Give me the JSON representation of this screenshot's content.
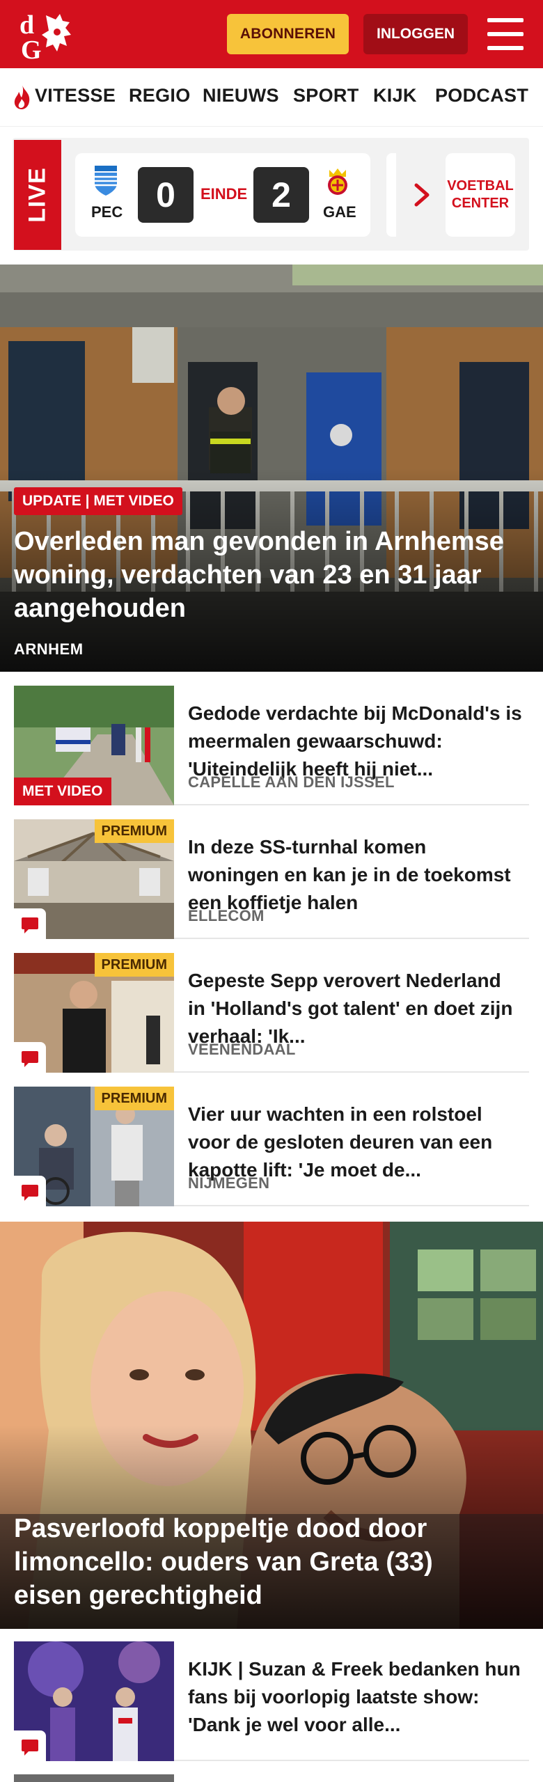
{
  "header": {
    "logo_letters": "dG",
    "subscribe_label": "ABONNEREN",
    "login_label": "INLOGGEN",
    "brand_color": "#d3101d",
    "accent_color": "#f7c33a"
  },
  "nav": {
    "items": [
      "VITESSE",
      "REGIO",
      "NIEUWS",
      "SPORT",
      "KIJK",
      "PODCAST"
    ]
  },
  "live": {
    "label": "LIVE",
    "home_team": "PEC",
    "home_score": "0",
    "status": "EINDE",
    "away_team": "GAE",
    "away_score": "2",
    "voetbal_center_label": "VOETBAL CENTER"
  },
  "hero1": {
    "badge": "UPDATE | MET VIDEO",
    "title": "Overleden man gevonden in Arnhemse woning, verdachten van 23 en 31 jaar aangehouden",
    "location": "ARNHEM"
  },
  "articles": [
    {
      "title": "Gedode verdachte bij McDonald's is meermalen gewaarschuwd: 'Uiteindelijk heeft hij niet...",
      "location": "CAPELLE AAN DEN IJSSEL",
      "badge": "MET VIDEO"
    },
    {
      "title": "In deze SS-turnhal komen woningen en kan je in de toekomst een koffietje halen",
      "location": "ELLECOM",
      "badge": "PREMIUM"
    },
    {
      "title": "Gepeste Sepp verovert Nederland in 'Holland's got talent' en doet zijn verhaal: 'Ik...",
      "location": "VEENENDAAL",
      "badge": "PREMIUM"
    },
    {
      "title": "Vier uur wachten in een rolstoel voor de gesloten deuren van een kapotte lift: 'Je moet de...",
      "location": "NIJMEGEN",
      "badge": "PREMIUM"
    }
  ],
  "hero2": {
    "title": "Pasverloofd koppeltje dood door limoncello: ouders van Greta (33) eisen gerechtigheid"
  },
  "articles2": [
    {
      "title": "KIJK | Suzan & Freek bedanken hun fans bij voorlopig laatste show: 'Dank je wel voor alle..."
    }
  ]
}
